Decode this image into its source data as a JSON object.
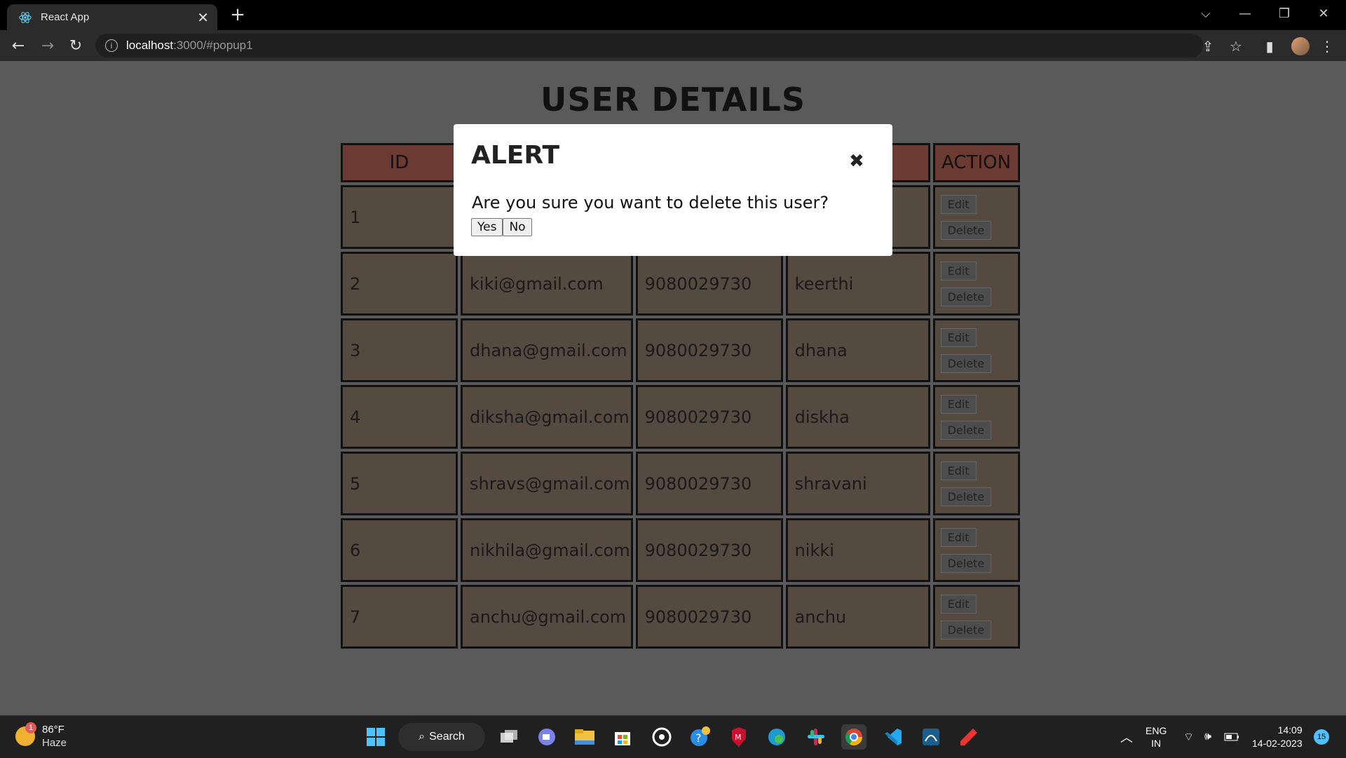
{
  "browser": {
    "tab_title": "React App",
    "url_host": "localhost",
    "url_path": ":3000/#popup1"
  },
  "page": {
    "heading": "USER DETAILS",
    "columns": [
      "ID",
      "",
      "",
      "",
      "ACTION"
    ],
    "rows": [
      {
        "id": "1",
        "email": "",
        "phone": "",
        "name": ""
      },
      {
        "id": "2",
        "email": "kiki@gmail.com",
        "phone": "9080029730",
        "name": "keerthi"
      },
      {
        "id": "3",
        "email": "dhana@gmail.com",
        "phone": "9080029730",
        "name": "dhana"
      },
      {
        "id": "4",
        "email": "diksha@gmail.com",
        "phone": "9080029730",
        "name": "diskha"
      },
      {
        "id": "5",
        "email": "shravs@gmail.com",
        "phone": "9080029730",
        "name": "shravani"
      },
      {
        "id": "6",
        "email": "nikhila@gmail.com",
        "phone": "9080029730",
        "name": "nikki"
      },
      {
        "id": "7",
        "email": "anchu@gmail.com",
        "phone": "9080029730",
        "name": "anchu"
      }
    ],
    "edit_label": "Edit",
    "delete_label": "Delete"
  },
  "modal": {
    "title": "ALERT",
    "close_glyph": "✖",
    "message": "Are you sure you want to delete this user?",
    "yes_label": "Yes",
    "no_label": "No"
  },
  "taskbar": {
    "weather_badge": "1",
    "temperature": "86°F",
    "condition": "Haze",
    "search_label": "Search",
    "lang_1": "ENG",
    "lang_2": "IN",
    "time": "14:09",
    "date": "14-02-2023",
    "notification_count": "15"
  },
  "colors": {
    "page_bg": "#5a5a5a",
    "header_cell": "#6b3a32",
    "body_cell": "#554a3f"
  }
}
